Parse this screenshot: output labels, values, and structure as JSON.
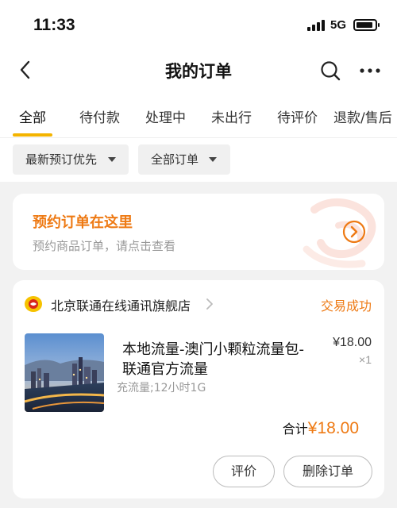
{
  "status_bar": {
    "time": "11:33",
    "network": "5G"
  },
  "header": {
    "title": "我的订单",
    "back_icon": "chevron-left-icon",
    "search_icon": "search-icon",
    "more_icon": "more-dots-icon"
  },
  "tabs": [
    {
      "label": "全部",
      "active": true
    },
    {
      "label": "待付款",
      "active": false
    },
    {
      "label": "处理中",
      "active": false
    },
    {
      "label": "未出行",
      "active": false
    },
    {
      "label": "待评价",
      "active": false
    },
    {
      "label": "退款/售后",
      "active": false
    }
  ],
  "filters": [
    {
      "label": "最新预订优先"
    },
    {
      "label": "全部订单"
    }
  ],
  "promo": {
    "title": "预约订单在这里",
    "subtitle": "预约商品订单，请点击查看",
    "accent": "#ee7a14"
  },
  "order": {
    "store_name": "北京联通在线通讯旗舰店",
    "status": "交易成功",
    "product_title": "本地流量-澳门小颗粒流量包-联通官方流量",
    "spec": "充流量;12小时1G",
    "unit_price": "¥18.00",
    "quantity": "×1",
    "total_label": "合计",
    "total_amount": "¥18.00",
    "actions": [
      {
        "label": "评价"
      },
      {
        "label": "删除订单"
      }
    ]
  }
}
